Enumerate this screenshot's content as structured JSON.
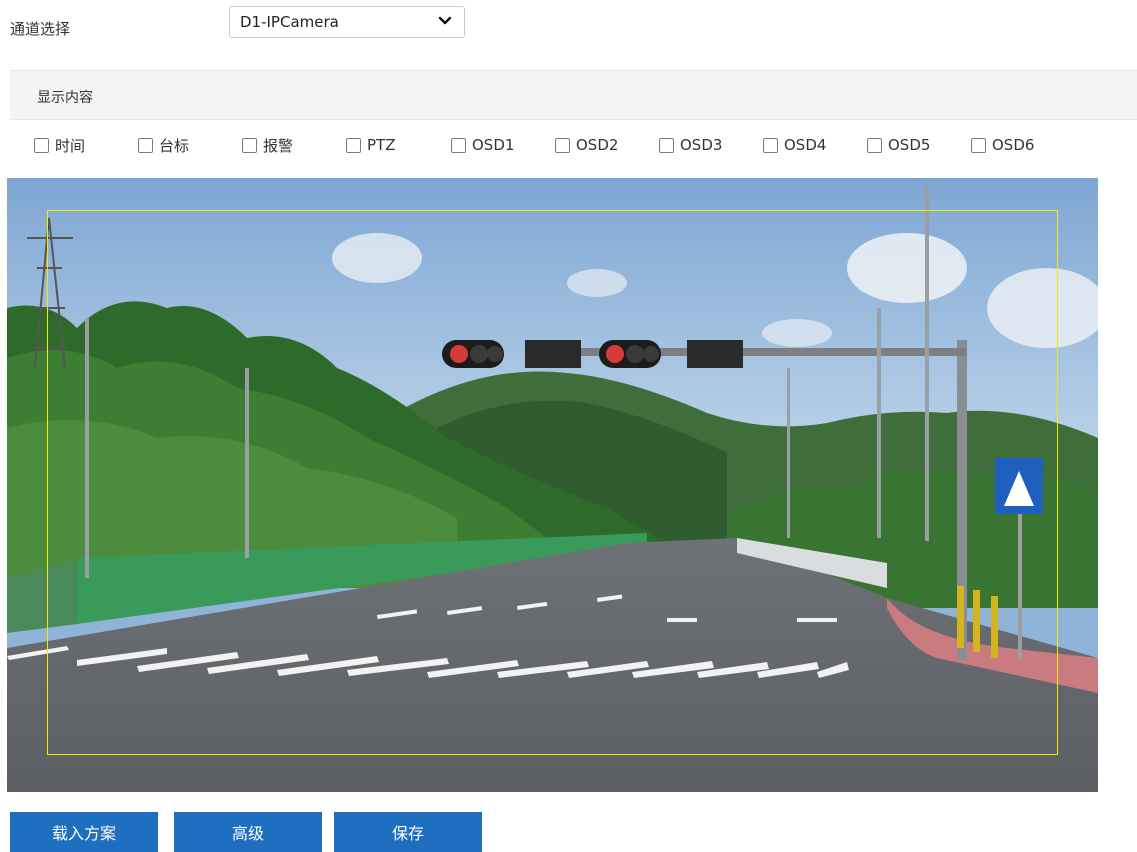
{
  "channel": {
    "label": "通道选择",
    "selected": "D1-IPCamera"
  },
  "section": {
    "title": "显示内容"
  },
  "checkboxes": [
    {
      "label": "时间",
      "checked": false
    },
    {
      "label": "台标",
      "checked": false
    },
    {
      "label": "报警",
      "checked": false
    },
    {
      "label": "PTZ",
      "checked": false
    },
    {
      "label": "OSD1",
      "checked": false
    },
    {
      "label": "OSD2",
      "checked": false
    },
    {
      "label": "OSD3",
      "checked": false
    },
    {
      "label": "OSD4",
      "checked": false
    },
    {
      "label": "OSD5",
      "checked": false
    },
    {
      "label": "OSD6",
      "checked": false
    }
  ],
  "buttons": {
    "load": "载入方案",
    "advanced": "高级",
    "save": "保存"
  },
  "colors": {
    "button": "#1f6fc1",
    "osd_frame": "#f2ec00",
    "header_bg": "#f2f4f6"
  }
}
